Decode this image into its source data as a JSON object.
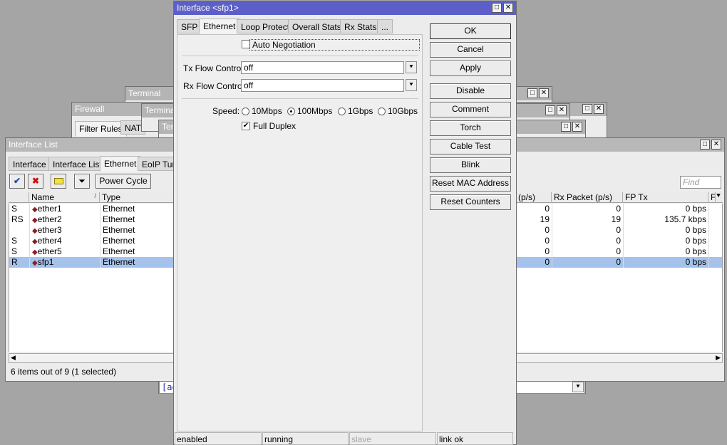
{
  "bg_windows": {
    "terminal1_title": "Terminal",
    "terminal2_title": "Terminal",
    "terminal3_title": "Ter",
    "firewall_title": "Firewall",
    "firewall_tabs": [
      "Filter Rules",
      "NAT"
    ],
    "terminal_input_text": "[ad"
  },
  "interface_list": {
    "title": "Interface List",
    "tabs": [
      "Interface",
      "Interface List",
      "Ethernet",
      "EoIP Tun"
    ],
    "selected_tab": "Ethernet",
    "power_cycle_label": "Power Cycle",
    "find_placeholder": "Find",
    "columns_left": [
      "",
      "Name",
      "Type"
    ],
    "columns_right": [
      "(p/s)",
      "Rx Packet (p/s)",
      "FP Tx",
      "F"
    ],
    "sort_indicator": "/",
    "rows": [
      {
        "flag": "S",
        "name": "ether1",
        "type": "Ethernet",
        "tx_pps": "0",
        "rx_pps": "0",
        "fp_tx": "0 bps"
      },
      {
        "flag": "RS",
        "name": "ether2",
        "type": "Ethernet",
        "tx_pps": "19",
        "rx_pps": "19",
        "fp_tx": "135.7 kbps"
      },
      {
        "flag": "",
        "name": "ether3",
        "type": "Ethernet",
        "tx_pps": "0",
        "rx_pps": "0",
        "fp_tx": "0 bps"
      },
      {
        "flag": "S",
        "name": "ether4",
        "type": "Ethernet",
        "tx_pps": "0",
        "rx_pps": "0",
        "fp_tx": "0 bps"
      },
      {
        "flag": "S",
        "name": "ether5",
        "type": "Ethernet",
        "tx_pps": "0",
        "rx_pps": "0",
        "fp_tx": "0 bps"
      },
      {
        "flag": "R",
        "name": "sfp1",
        "type": "Ethernet",
        "tx_pps": "0",
        "rx_pps": "0",
        "fp_tx": "0 bps",
        "selected": true
      }
    ],
    "status": "6 items out of 9 (1 selected)"
  },
  "dialog": {
    "title": "Interface <sfp1>",
    "tabs": [
      "SFP",
      "Ethernet",
      "Loop Protect",
      "Overall Stats",
      "Rx Stats",
      "..."
    ],
    "selected_tab": "Ethernet",
    "auto_negotiation_label": "Auto Negotiation",
    "auto_negotiation_checked": false,
    "tx_flow_label": "Tx Flow Control:",
    "tx_flow_value": "off",
    "rx_flow_label": "Rx Flow Control:",
    "rx_flow_value": "off",
    "speed_label": "Speed:",
    "speed_options": [
      "10Mbps",
      "100Mbps",
      "1Gbps",
      "10Gbps"
    ],
    "speed_selected": "100Mbps",
    "full_duplex_label": "Full Duplex",
    "full_duplex_checked": true,
    "buttons": [
      "OK",
      "Cancel",
      "Apply",
      "Disable",
      "Comment",
      "Torch",
      "Cable Test",
      "Blink",
      "Reset MAC Address",
      "Reset Counters"
    ],
    "status": [
      "enabled",
      "running",
      "slave",
      "link ok"
    ]
  },
  "colors": {
    "active_title": "#5d5fc9",
    "inactive_title": "#b4b4b4",
    "selected_row": "#a4c2eb",
    "desktop": "#a5a5a5"
  }
}
